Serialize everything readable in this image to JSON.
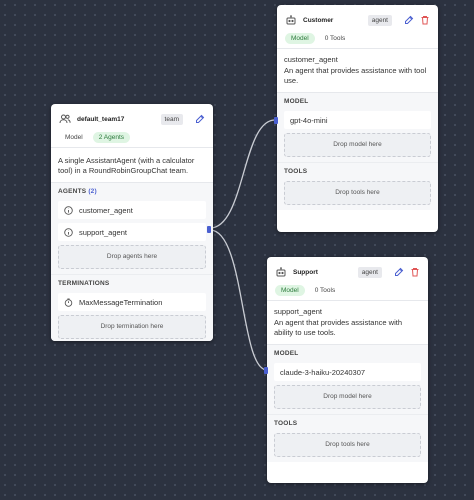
{
  "team": {
    "title": "default_team17",
    "tag": "team",
    "pills": [
      "Model",
      "2 Agents"
    ],
    "description": "A single AssistantAgent (with a calculator tool) in a RoundRobinGroupChat team.",
    "agents_label": "AGENTS",
    "agents_count": "(2)",
    "agents": [
      "customer_agent",
      "support_agent"
    ],
    "drop_agents": "Drop agents here",
    "terminations_label": "TERMINATIONS",
    "terminations": [
      "MaxMessageTermination"
    ],
    "drop_termination": "Drop termination here"
  },
  "customer": {
    "title": "Customer",
    "tag": "agent",
    "pills": [
      "Model",
      "0 Tools"
    ],
    "name": "customer_agent",
    "description": "An agent that provides assistance with tool use.",
    "model_label": "MODEL",
    "model": "gpt-4o-mini",
    "drop_model": "Drop model here",
    "tools_label": "TOOLS",
    "drop_tools": "Drop tools here"
  },
  "support": {
    "title": "Support",
    "tag": "agent",
    "pills": [
      "Model",
      "0 Tools"
    ],
    "name": "support_agent",
    "description": "An agent that provides assistance with ability to use tools.",
    "model_label": "MODEL",
    "model": "claude-3-haiku-20240307",
    "drop_model": "Drop model here",
    "tools_label": "TOOLS",
    "drop_tools": "Drop tools here"
  },
  "colors": {
    "canvas": "#2c3240",
    "accent": "#4a5fd0",
    "delete": "#e05555",
    "edge": "#c9ccd3"
  },
  "icons": [
    "team-icon",
    "robot-icon",
    "edit-icon",
    "delete-icon",
    "info-icon",
    "timer-icon"
  ]
}
